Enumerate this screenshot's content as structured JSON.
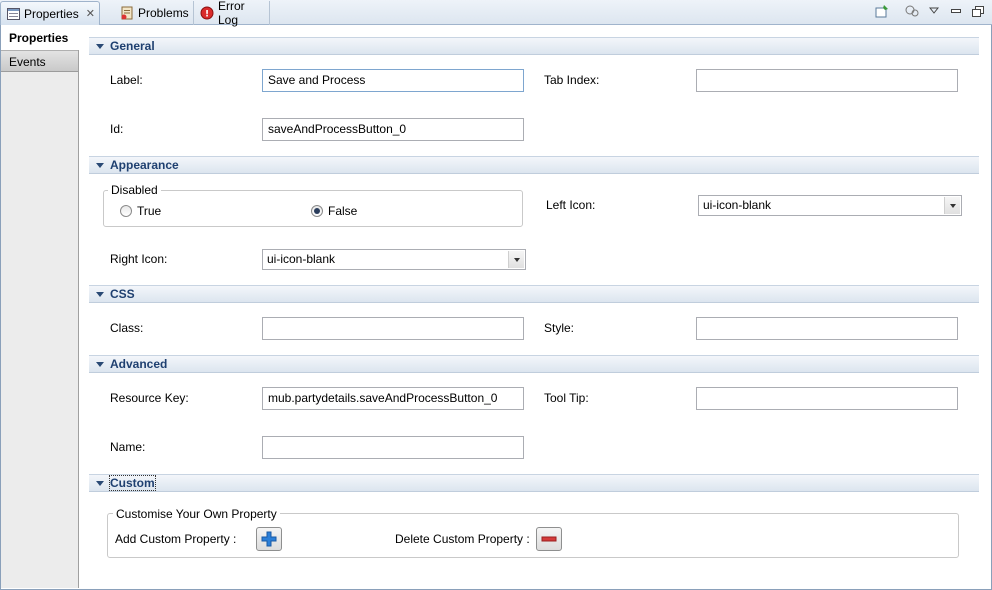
{
  "tabs": [
    {
      "label": "Properties",
      "icon": "properties-icon",
      "active": true
    },
    {
      "label": "Problems",
      "icon": "problems-icon"
    },
    {
      "label": "Error Log",
      "icon": "error-log-icon"
    }
  ],
  "toolbar_icons": [
    "pin-icon",
    "filter-icon",
    "view-menu-icon",
    "minimize-icon",
    "maximize-icon"
  ],
  "nav": {
    "items": [
      {
        "label": "Properties"
      },
      {
        "label": "Events"
      }
    ]
  },
  "sections": {
    "general": {
      "title": "General",
      "label_label": "Label:",
      "label_value": "Save and Process",
      "tabindex_label": "Tab Index:",
      "tabindex_value": "",
      "id_label": "Id:",
      "id_value": "saveAndProcessButton_0"
    },
    "appearance": {
      "title": "Appearance",
      "disabled_group": "Disabled",
      "true_label": "True",
      "false_label": "False",
      "selected": "False",
      "left_icon_label": "Left Icon:",
      "left_icon_value": "ui-icon-blank",
      "right_icon_label": "Right Icon:",
      "right_icon_value": "ui-icon-blank"
    },
    "css": {
      "title": "CSS",
      "class_label": "Class:",
      "class_value": "",
      "style_label": "Style:",
      "style_value": ""
    },
    "advanced": {
      "title": "Advanced",
      "resource_key_label": "Resource Key:",
      "resource_key_value": "mub.partydetails.saveAndProcessButton_0",
      "tooltip_label": "Tool Tip:",
      "tooltip_value": "",
      "name_label": "Name:",
      "name_value": ""
    },
    "custom": {
      "title": "Custom",
      "group_title": "Customise Your Own Property",
      "add_label": "Add Custom Property :",
      "delete_label": "Delete Custom Property :"
    }
  },
  "colors": {
    "section_title": "#1f4070",
    "add_button": "#2b7fd8",
    "delete_button": "#d43a3a"
  }
}
